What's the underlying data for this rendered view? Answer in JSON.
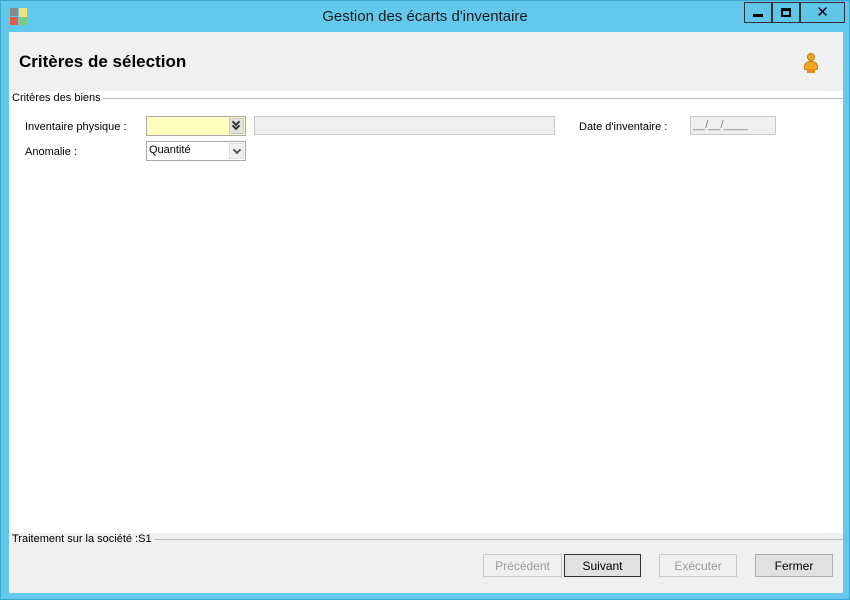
{
  "window": {
    "title": "Gestion des écarts d'inventaire",
    "controls": {
      "minimize": "minimize-icon",
      "maximize": "maximize-icon",
      "close": "close-icon"
    }
  },
  "header": {
    "title": "Critères de sélection",
    "user_icon": "user-icon"
  },
  "criteria_group": {
    "label": "Critères des biens",
    "inventory_label": "Inventaire physique :",
    "inventory_value": "",
    "inventory_description": "",
    "date_label": "Date d'inventaire :",
    "date_value": "__/__/____",
    "anomaly_label": "Anomalie :",
    "anomaly_value": "Quantité"
  },
  "footer": {
    "company_label": "Traitement sur la société :S1",
    "buttons": {
      "previous": {
        "label": "Précédent",
        "enabled": false
      },
      "next": {
        "label": "Suivant",
        "enabled": true
      },
      "execute": {
        "label": "Exécuter",
        "enabled": false
      },
      "close": {
        "label": "Fermer",
        "enabled": true
      }
    }
  },
  "colors": {
    "titlebar": "#63c8ec",
    "panel": "#f0f0f0",
    "mandatory_field": "#ffffc0",
    "user_icon": "#f5a623"
  }
}
